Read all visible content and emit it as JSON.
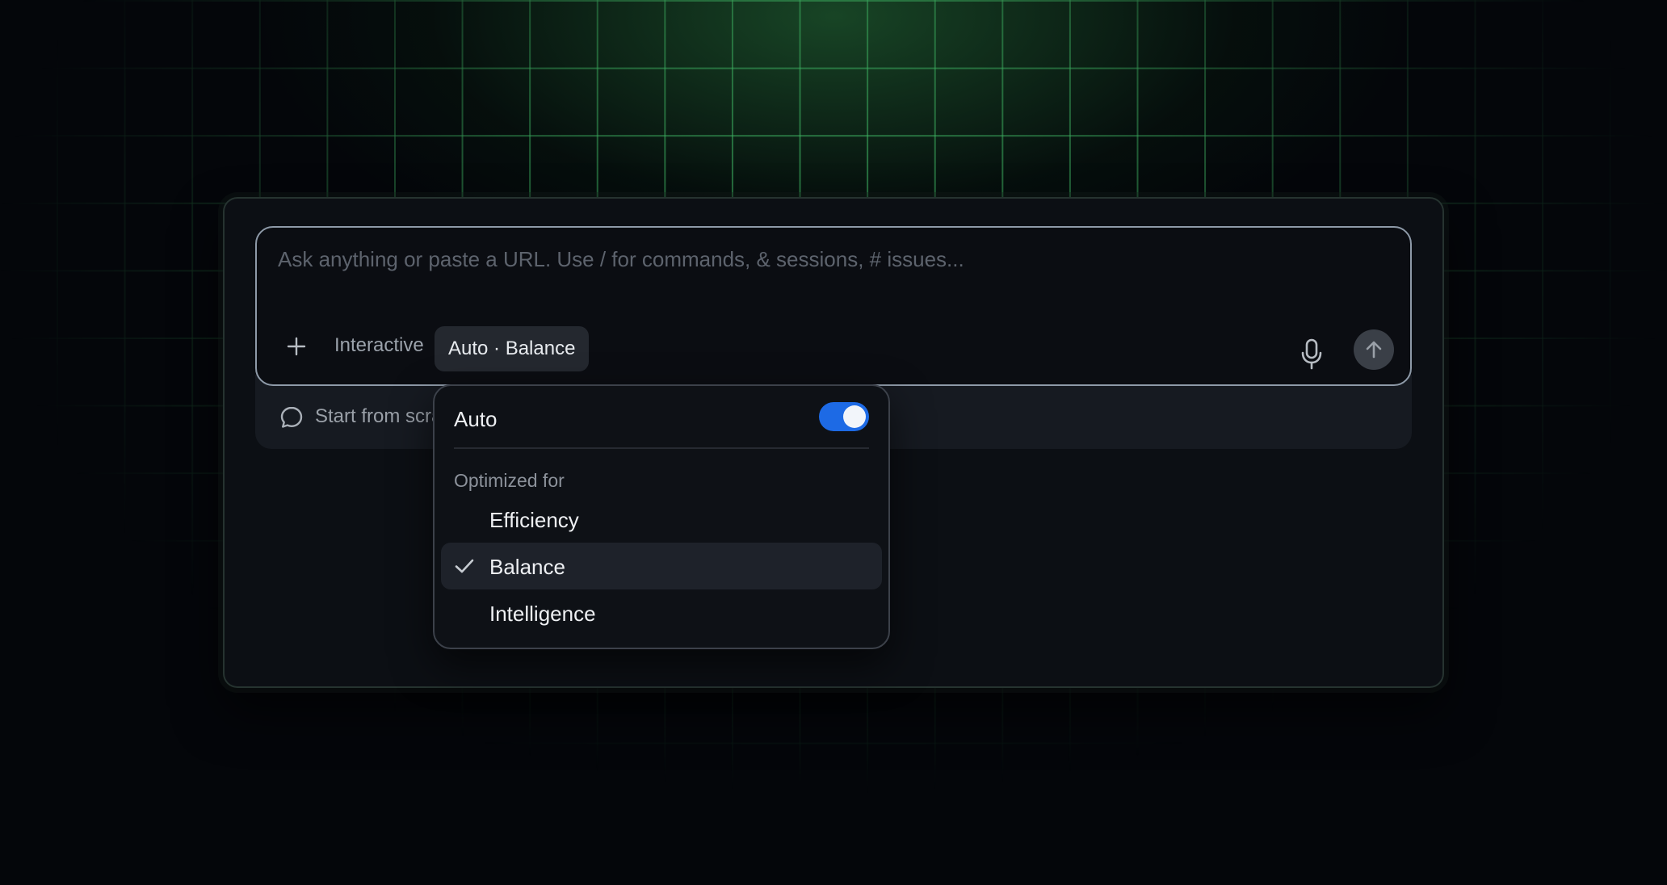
{
  "composer": {
    "placeholder": "Ask anything or paste a URL. Use / for commands, & sessions, # issues...",
    "mode_label": "Interactive",
    "model_chip_label": "Auto · Balance",
    "icons": {
      "add": "plus-icon",
      "voice": "microphone-icon",
      "send": "arrow-up-icon"
    }
  },
  "scratch": {
    "label": "Start from scratch",
    "icon": "chat-bubble-icon"
  },
  "dropdown": {
    "auto_label": "Auto",
    "auto_enabled": true,
    "section_label": "Optimized for",
    "options": [
      {
        "label": "Efficiency",
        "selected": false
      },
      {
        "label": "Balance",
        "selected": true
      },
      {
        "label": "Intelligence",
        "selected": false
      }
    ]
  },
  "colors": {
    "accent": "#1d6ae5",
    "grid": "#46c86e"
  }
}
